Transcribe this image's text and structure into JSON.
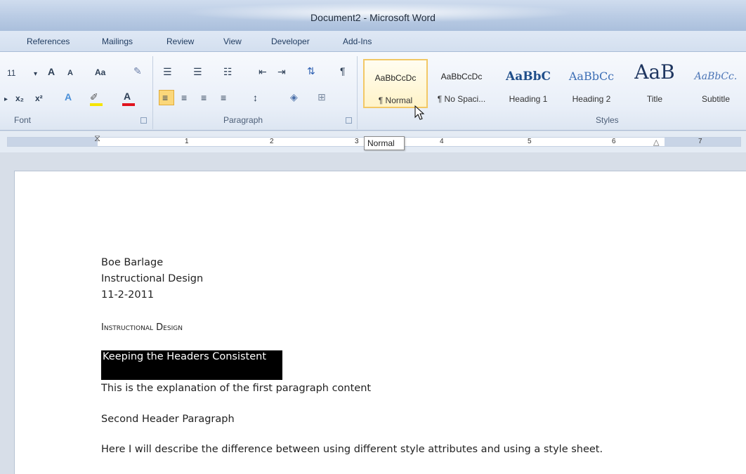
{
  "window": {
    "title": "Document2 - Microsoft Word"
  },
  "tabs": [
    "References",
    "Mailings",
    "Review",
    "View",
    "Developer",
    "Add-Ins"
  ],
  "font_group": {
    "label": "Font",
    "size": "11",
    "grow_font": "A",
    "shrink_font": "A",
    "change_case": "Aa",
    "subscript": "x₂",
    "superscript": "x²",
    "font_color": "A"
  },
  "paragraph_group": {
    "label": "Paragraph"
  },
  "styles_group": {
    "label": "Styles",
    "items": [
      {
        "preview": "AaBbCcDc",
        "name": "¶ Normal",
        "selected": true
      },
      {
        "preview": "AaBbCcDc",
        "name": "¶ No Spaci..."
      },
      {
        "preview": "AaBbC",
        "name": "Heading 1"
      },
      {
        "preview": "AaBbCc",
        "name": "Heading 2"
      },
      {
        "preview": "AaB",
        "name": "Title"
      },
      {
        "preview": "AaBbCc.",
        "name": "Subtitle"
      }
    ]
  },
  "ruler": {
    "numbers": [
      "1",
      "2",
      "3",
      "4",
      "5",
      "6",
      "7"
    ]
  },
  "tooltip": "Normal",
  "document": {
    "author": "Boe Barlage",
    "course": "Instructional Design",
    "date": "11-2-2011",
    "title": "Instructional Design",
    "header1": "Keeping the Headers Consistent",
    "para1": "This is the explanation of the first paragraph content",
    "header2": "Second Header Paragraph",
    "para2": "Here I will describe the difference between using different style attributes and using a style sheet."
  },
  "colors": {
    "highlight": "#f5e400",
    "font_color_bar": "#e0141e",
    "selection": "#000000"
  }
}
